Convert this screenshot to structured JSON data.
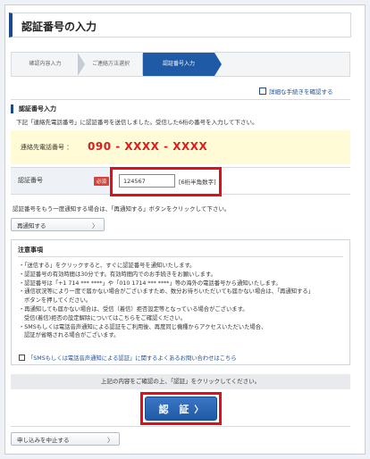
{
  "header": {
    "title": "認証番号の入力"
  },
  "steps": [
    {
      "label": "確認内容入力"
    },
    {
      "label": "ご連絡方法選択"
    },
    {
      "label": "認証番号入力"
    }
  ],
  "detail_link": "詳細な手続きを確認する",
  "section": {
    "heading": "認証番号入力",
    "description": "下記「連絡先電話番号」に認証番号を送信しました。受信した6桁の番号を入力して下さい。"
  },
  "phone": {
    "label": "連絡先電話番号 ：",
    "number": "090 - XXXX - XXXX"
  },
  "code": {
    "label": "認証番号",
    "required": "必須",
    "value": "124567",
    "hint": "[6桁半角数字]"
  },
  "resend": {
    "description": "認証番号をもう一度通知する場合は、「再通知する」ボタンをクリックして下さい。",
    "button": "再通知する"
  },
  "notice": {
    "heading": "注意事項",
    "items": [
      {
        "text": "・「送信する」をクリックすると、すぐに認証番号を通知いたします。",
        "sub": false
      },
      {
        "text": "・認証番号の有効時間は30分です。有効時間内でのお手続きをお願いします。",
        "sub": false
      },
      {
        "text": "・認証番号は「+1 714 *** ****」や「010 1714 *** ****」等の海外の電話番号から通知いたします。",
        "sub": false
      },
      {
        "text": "・通信状況等により一度で届かない場合がございますため、数分お待ちいただいても届かない場合は、「再通知する」",
        "sub": false
      },
      {
        "text": "ボタンを押してください。",
        "sub": true
      },
      {
        "text": "・再通知しても届かない場合は、受信（着信）拒否設定等となっている場合がございます。",
        "sub": false
      },
      {
        "text": "受信(着信)拒否の設定解除についてはこちらをご確認ください。",
        "sub": true
      },
      {
        "text": "・SMSもしくは電話音声通知による認証をご利用後、再度同じ機種からアクセスいただいた場合、",
        "sub": false
      },
      {
        "text": "認証が省略される場合がございます。",
        "sub": true
      }
    ],
    "faq_link": "「SMSもしくは電話音声通知による認証」に関するよくあるお問い合わせはこちら"
  },
  "confirm": {
    "text": "上記の内容をご確認の上、「認証」をクリックしてください。",
    "button": "認 証",
    "button_arrow": "〉"
  },
  "cancel_button": "申し込みを中止する",
  "arrow": "〉",
  "colors": {
    "accent": "#1f5aa6",
    "phone_red": "#d91c1c",
    "highlight": "#e20f1b",
    "phone_bg": "#fffbd6"
  }
}
